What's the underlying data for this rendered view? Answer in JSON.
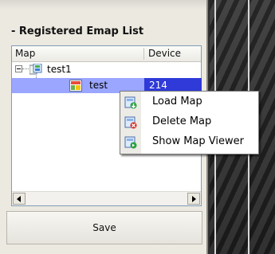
{
  "panel": {
    "section_title": "- Registered Emap List",
    "columns": {
      "map": "Map",
      "device": "Device"
    },
    "tree": [
      {
        "label": "test1",
        "device": "",
        "level": 0,
        "expanded": true
      },
      {
        "label": "test",
        "device": "214",
        "level": 1,
        "selected": true
      }
    ],
    "save_label": "Save"
  },
  "context_menu": {
    "items": [
      {
        "label": "Load Map",
        "icon": "load-map-icon"
      },
      {
        "label": "Delete Map",
        "icon": "delete-map-icon"
      },
      {
        "label": "Show Map Viewer",
        "icon": "show-map-viewer-icon"
      }
    ]
  },
  "colors": {
    "selection": "#9aa6ff",
    "selection_dark": "#2f3ad8",
    "panel_bg": "#ece9e0"
  }
}
